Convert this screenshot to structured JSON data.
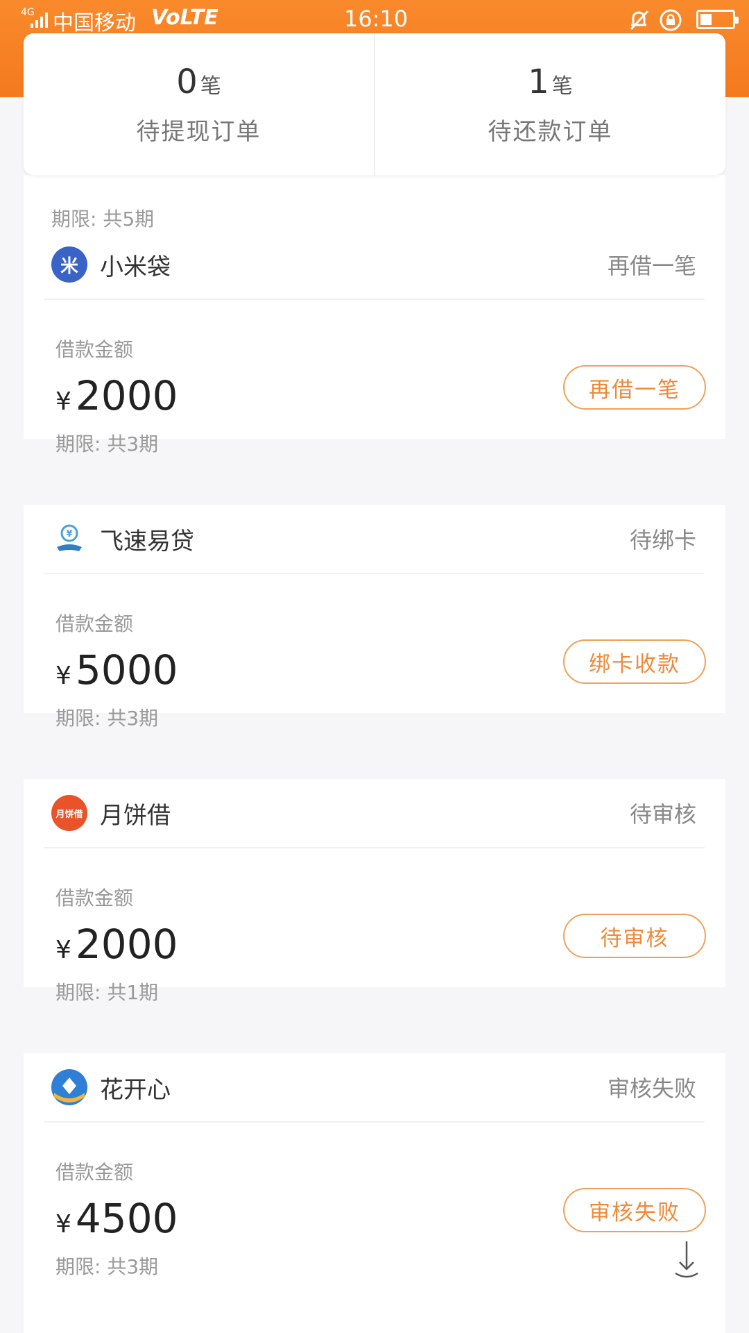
{
  "status_bar": {
    "signal_tag": "4G",
    "carrier": "中国移动",
    "volte": "VoLTE",
    "time": "16:10",
    "icons": [
      "mute-icon",
      "rotation-lock-icon",
      "battery-icon"
    ]
  },
  "summary": {
    "withdraw": {
      "count": "0",
      "unit": "笔",
      "label": "待提现订单"
    },
    "repay": {
      "count": "1",
      "unit": "笔",
      "label": "待还款订单"
    }
  },
  "partial_card": {
    "term": "期限: 共5期"
  },
  "loans": [
    {
      "name": "小米袋",
      "logo_text": "米",
      "logo_color": "#3a63c7",
      "status": "再借一笔",
      "amount_label": "借款金额",
      "currency": "¥",
      "amount": "2000",
      "term": "期限: 共3期",
      "action": "再借一笔"
    },
    {
      "name": "飞速易贷",
      "logo_text": "",
      "logo_color": "#4aa0d8",
      "status": "待绑卡",
      "amount_label": "借款金额",
      "currency": "¥",
      "amount": "5000",
      "term": "期限: 共3期",
      "action": "绑卡收款"
    },
    {
      "name": "月饼借",
      "logo_text": "月饼借",
      "logo_color": "#e9532a",
      "status": "待审核",
      "amount_label": "借款金额",
      "currency": "¥",
      "amount": "2000",
      "term": "期限: 共1期",
      "action": "待审核"
    },
    {
      "name": "花开心",
      "logo_text": "",
      "logo_color": "#2f7fd6",
      "status": "审核失败",
      "amount_label": "借款金额",
      "currency": "¥",
      "amount": "4500",
      "term": "期限: 共3期",
      "action": "审核失败"
    }
  ],
  "colors": {
    "header": "#f47a1e",
    "action_border": "#f0a05a",
    "action_text": "#ee8a3a"
  }
}
